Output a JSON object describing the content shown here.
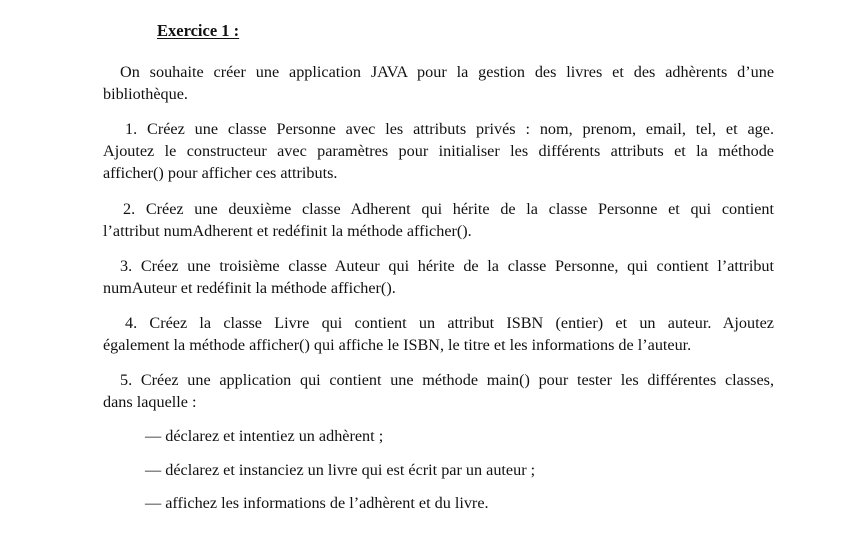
{
  "title": "Exercice 1 :",
  "intro": {
    "line1": "On souhaite créer une application JAVA pour la gestion des livres et des adhèrents d’une",
    "line2": "bibliothèque."
  },
  "items": [
    {
      "line1": "1. Créez une classe Personne avec les attributs privés : nom, prenom, email, tel, et age.",
      "line2": "Ajoutez le constructeur avec paramètres pour initialiser les différents attributs et la méthode",
      "line3": "afficher() pour afficher ces attributs."
    },
    {
      "line1": "2. Créez une deuxième classe Adherent qui hérite de la classe Personne et qui contient",
      "line2": "l’attribut numAdherent et redéfinit la méthode afficher()."
    },
    {
      "line1": "3. Créez une troisième classe Auteur qui hérite de la classe Personne, qui contient l’attribut",
      "line2": "numAuteur et redéfinit la méthode afficher()."
    },
    {
      "line1": "4. Créez la classe Livre qui contient un attribut ISBN (entier) et un auteur. Ajoutez",
      "line2": "également la méthode afficher() qui affiche le ISBN, le titre et les informations de l’auteur."
    },
    {
      "line1": "5. Créez une application qui contient une méthode main() pour tester les différentes classes,",
      "line2": "dans laquelle :"
    }
  ],
  "bullets": [
    "— déclarez et intentiez un adhèrent ;",
    "— déclarez et instanciez un livre qui est écrit par un auteur ;",
    "— affichez les informations de l’adhèrent et du livre."
  ]
}
